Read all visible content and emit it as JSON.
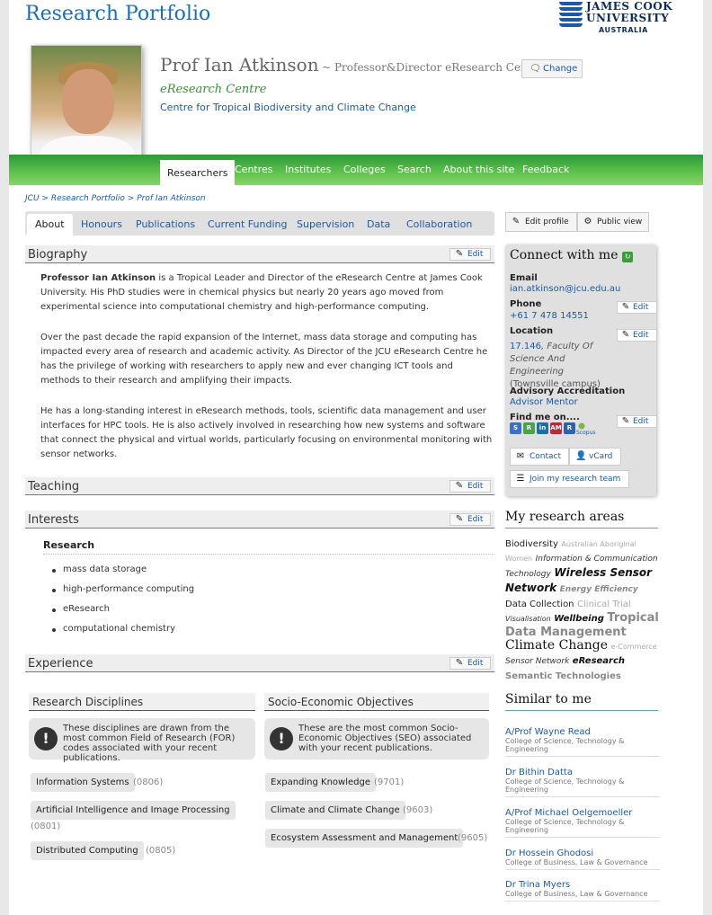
{
  "site": {
    "title": "Research Portfolio"
  },
  "logo": {
    "line1": "JAMES COOK",
    "line2": "UNIVERSITY",
    "line3": "AUSTRALIA"
  },
  "profile": {
    "name": "Prof Ian Atkinson",
    "title": "~ Professor&Director eResearch Centre",
    "change_label": "Change",
    "org_primary": "eResearch Centre",
    "org_secondary": "Centre for Tropical Biodiversity and Climate Change"
  },
  "nav": {
    "items": [
      "Researchers",
      "Centres",
      "Institutes",
      "Colleges",
      "Search",
      "About this site",
      "Feedback"
    ],
    "active": "Researchers"
  },
  "breadcrumb": {
    "items": [
      "JCU",
      "Research Portfolio",
      "Prof Ian Atkinson"
    ],
    "sep": ">"
  },
  "subtabs": {
    "items": [
      "About",
      "Honours",
      "Publications",
      "Current Funding",
      "Supervision",
      "Data",
      "Collaboration"
    ],
    "active": "About"
  },
  "edit_label": "Edit",
  "sections": {
    "biography": "Biography",
    "teaching": "Teaching",
    "interests": "Interests",
    "experience": "Experience"
  },
  "biography": {
    "p1_bold": "Professor Ian Atkinson",
    "p1": " is a Tropical Leader and Director of the eResearch Centre at James Cook University. His PhD studies were in chemical physics but nearly 20 years ago moved from experimental science into computational chemistry and high-performance computing.",
    "p2": "Over the past decade the rapid expansion of the Internet, mass data storage and computing has impacted every area of research and academic activity. As Director of the JCU eResearch Centre he has the privilege of working with researchers to apply new and ever changing ICT tools and methods to their research and amplifying their impacts.",
    "p3": "He has a long-standing interest in eResearch methods, tools, scientific data management and user interfaces for HPC tools. He is also actively involved in researching how new systems and software that connect the physical and virtual worlds, particularly focusing on environmental monitoring with sensor networks."
  },
  "interests": {
    "heading": "Research",
    "items": [
      "mass data storage",
      "high-performance computing",
      "eResearch",
      "computational chemistry"
    ]
  },
  "disciplines": {
    "heading": "Research Disciplines",
    "note": "These disciplines are drawn from the most common Field of Research (FOR) codes associated with your recent publications.",
    "items": [
      {
        "label": "Information Systems",
        "code": "(0806)"
      },
      {
        "label": "Artificial Intelligence and Image Processing",
        "code": "(0801)"
      },
      {
        "label": "Distributed Computing",
        "code": "(0805)"
      }
    ]
  },
  "seo": {
    "heading": "Socio-Economic Objectives",
    "note": "These are the most common Socio-Economic Objectives (SEO) associated with your recent publications.",
    "items": [
      {
        "label": "Expanding Knowledge",
        "code": "(9701)"
      },
      {
        "label": "Climate and Climate Change",
        "code": "(9603)"
      },
      {
        "label": "Ecosystem Assessment and Management",
        "code": "(9605)"
      }
    ]
  },
  "sidebar": {
    "edit_profile": "Edit profile",
    "public_view": "Public view",
    "connect_heading": "Connect with me",
    "email_label": "Email",
    "email": "ian.atkinson@jcu.edu.au",
    "phone_label": "Phone",
    "phone": "+61 7 478 14551",
    "location_label": "Location",
    "location_room": "17.146",
    "location_faculty": ", Faculty Of Science And Engineering",
    "location_campus": "(Townsville campus)",
    "advisory_label": "Advisory Accreditation",
    "advisory_value": "Advisor Mentor",
    "find_label": "Find me on....",
    "social": [
      "S",
      "R",
      "in",
      "AM",
      "R",
      "Scopus"
    ],
    "contact_label": "Contact",
    "vcard_label": "vCard",
    "join_label": "Join my research team",
    "areas_heading": "My research areas",
    "similar_heading": "Similar to me",
    "similar": [
      {
        "name": "A/Prof Wayne Read",
        "college": "College of Science, Technology & Engineering"
      },
      {
        "name": "Dr Bithin Datta",
        "college": "College of Science, Technology & Engineering"
      },
      {
        "name": "A/Prof Michael Oelgemoeller",
        "college": "College of Science, Technology & Engineering"
      },
      {
        "name": "Dr Hossein Ghodosi",
        "college": "College of Business, Law & Governance"
      },
      {
        "name": "Dr Trina Myers",
        "college": "College of Business, Law & Governance"
      }
    ]
  },
  "tag_cloud": [
    {
      "t": "Biodiversity",
      "size": 10,
      "color": "#222",
      "style": "normal"
    },
    {
      "t": "Australian Aboriginal Women",
      "size": 8,
      "color": "#aaa",
      "style": "normal"
    },
    {
      "t": "Information & Communication Technology",
      "size": 9,
      "color": "#333",
      "style": "italic"
    },
    {
      "t": "Wireless Sensor Network",
      "size": 12,
      "color": "#111",
      "style": "bolditalic"
    },
    {
      "t": "Energy Efficiency",
      "size": 9,
      "color": "#888",
      "style": "bolditalic"
    },
    {
      "t": "Data Collection",
      "size": 10,
      "color": "#222",
      "style": "normal"
    },
    {
      "t": "Clinical Trial",
      "size": 10,
      "color": "#aaa",
      "style": "normal"
    },
    {
      "t": "Visualisation",
      "size": 8,
      "color": "#333",
      "style": "italic"
    },
    {
      "t": "Wellbeing",
      "size": 10,
      "color": "#111",
      "style": "bolditalic"
    },
    {
      "t": "Tropical Data Management",
      "size": 13,
      "color": "#888",
      "style": "bold"
    },
    {
      "t": "Climate Change",
      "size": 14,
      "color": "#111",
      "style": "serif"
    },
    {
      "t": "e-Commerce",
      "size": 8,
      "color": "#aaa",
      "style": "normal"
    },
    {
      "t": "Sensor Network",
      "size": 9,
      "color": "#333",
      "style": "italic"
    },
    {
      "t": "eResearch",
      "size": 10,
      "color": "#111",
      "style": "bolditalic"
    },
    {
      "t": "Semantic Technologies",
      "size": 10,
      "color": "#888",
      "style": "bold"
    }
  ]
}
